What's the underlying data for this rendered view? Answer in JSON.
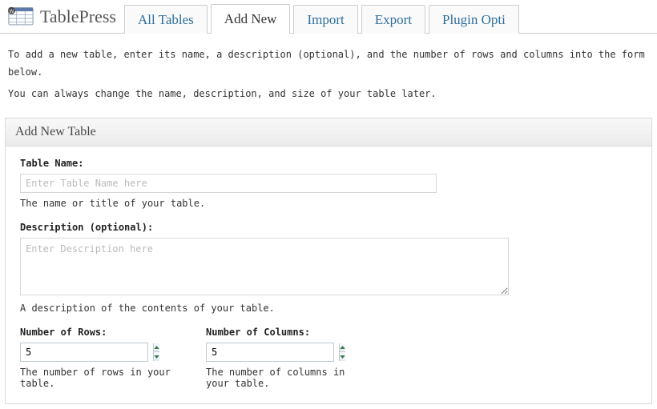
{
  "header": {
    "app_title": "TablePress",
    "tabs": [
      {
        "label": "All Tables",
        "active": false
      },
      {
        "label": "Add New",
        "active": true
      },
      {
        "label": "Import",
        "active": false
      },
      {
        "label": "Export",
        "active": false
      },
      {
        "label": "Plugin Opti",
        "active": false
      }
    ]
  },
  "instructions": {
    "line1": "To add a new table, enter its name, a description (optional), and the number of rows and columns into the form below.",
    "line2": "You can always change the name, description, and size of your table later."
  },
  "panel": {
    "title": "Add New Table",
    "table_name": {
      "label": "Table Name:",
      "placeholder": "Enter Table Name here",
      "value": "",
      "help": "The name or title of your table."
    },
    "description": {
      "label": "Description (optional):",
      "placeholder": "Enter Description here",
      "value": "",
      "help": "A description of the contents of your table."
    },
    "rows": {
      "label": "Number of Rows:",
      "value": "5",
      "help": "The number of rows in your table."
    },
    "columns": {
      "label": "Number of Columns:",
      "value": "5",
      "help": "The number of columns in your table."
    }
  }
}
